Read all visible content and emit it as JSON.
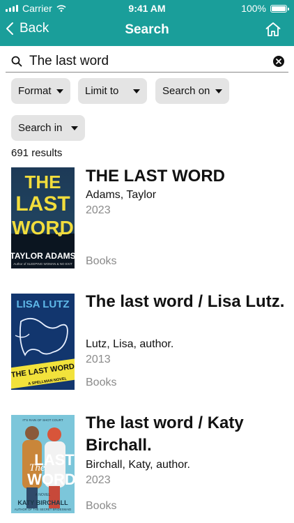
{
  "status_bar": {
    "carrier": "Carrier",
    "time": "9:41 AM",
    "battery": "100%",
    "battery_level": 1.0
  },
  "nav": {
    "back_label": "Back",
    "title": "Search"
  },
  "search": {
    "value": "The last word"
  },
  "filters": [
    "Format",
    "Limit to",
    "Search on",
    "Search in"
  ],
  "result_count": "691 results",
  "results": [
    {
      "title": "THE LAST WORD",
      "author": "Adams, Taylor",
      "year": "2023",
      "format": "Books",
      "cover": {
        "title_text": "THE LAST WORD",
        "author_text": "TAYLOR ADAMS",
        "tagline": "Author of SLEEPING WOMAN & NO EXIT"
      }
    },
    {
      "title": "The last word / Lisa Lutz.",
      "author": "Lutz, Lisa, author.",
      "year": "2013",
      "format": "Books",
      "cover": {
        "author_text": "LISA LUTZ",
        "title_text": "THE LAST WORD",
        "tagline": "A SPELLMAN NOVEL"
      }
    },
    {
      "title": "The last word / Katy Birchall.",
      "author": "Birchall, Katy, author.",
      "year": "2023",
      "format": "Books",
      "cover": {
        "top_text": "IT'S RAIN OF SHOT COURT",
        "title_the": "The",
        "title_last": "LAST",
        "title_word": "WORD",
        "label": "A NOVEL",
        "author_text": "KATY BIRCHALL",
        "tagline": "AUTHOR OF THE SECRET BRIDESMAID"
      }
    }
  ],
  "colors": {
    "header": "#1a9e9a",
    "chip_bg": "#e4e4e4",
    "muted_text": "#8a8a8a"
  }
}
